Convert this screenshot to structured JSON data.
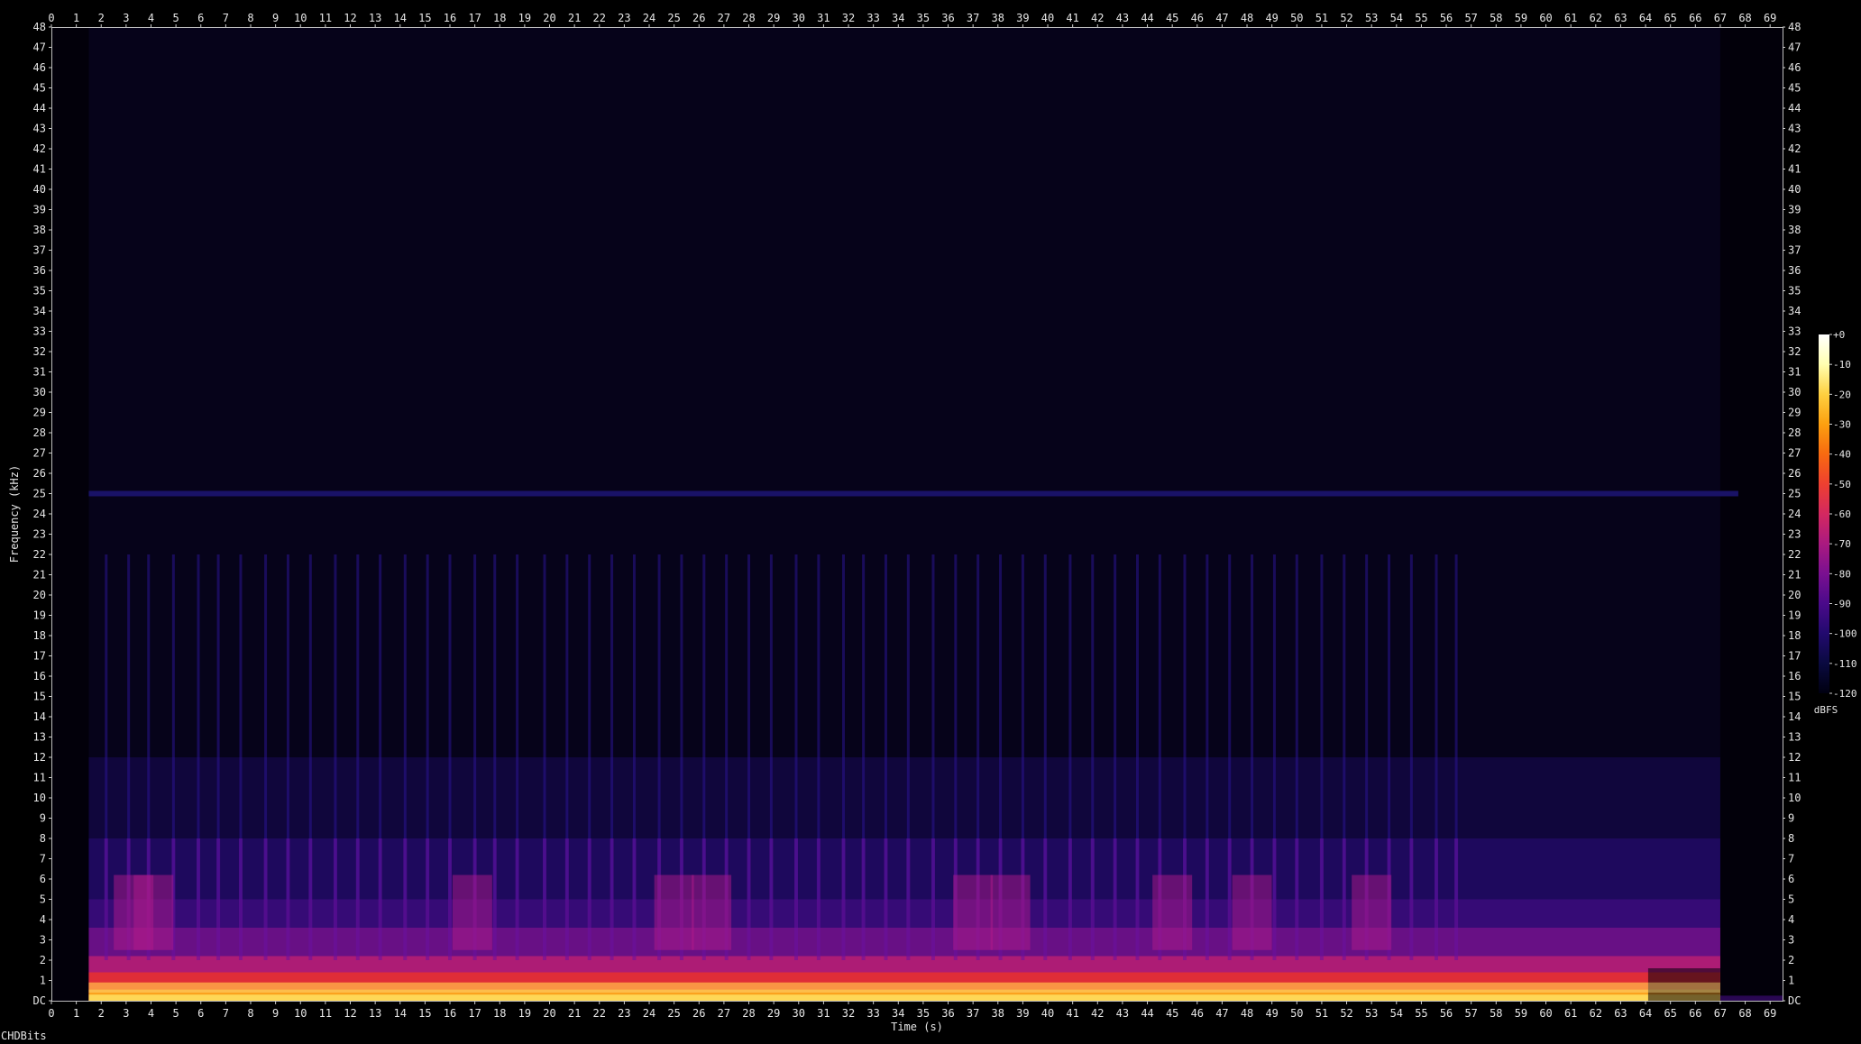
{
  "chart_data": {
    "type": "heatmap",
    "title": "",
    "xlabel": "Time (s)",
    "ylabel": "Frequency (kHz)",
    "xlim": [
      0,
      69.5
    ],
    "ylim": [
      0,
      48
    ],
    "x_ticks": [
      0,
      1,
      2,
      3,
      4,
      5,
      6,
      7,
      8,
      9,
      10,
      11,
      12,
      13,
      14,
      15,
      16,
      17,
      18,
      19,
      20,
      21,
      22,
      23,
      24,
      25,
      26,
      27,
      28,
      29,
      30,
      31,
      32,
      33,
      34,
      35,
      36,
      37,
      38,
      39,
      40,
      41,
      42,
      43,
      44,
      45,
      46,
      47,
      48,
      49,
      50,
      51,
      52,
      53,
      54,
      55,
      56,
      57,
      58,
      59,
      60,
      61,
      62,
      63,
      64,
      65,
      66,
      67,
      68,
      69
    ],
    "y_ticks": [
      "DC",
      "1",
      "2",
      "3",
      "4",
      "5",
      "6",
      "7",
      "8",
      "9",
      "10",
      "11",
      "12",
      "13",
      "14",
      "15",
      "16",
      "17",
      "18",
      "19",
      "20",
      "21",
      "22",
      "23",
      "24",
      "25",
      "26",
      "27",
      "28",
      "29",
      "30",
      "31",
      "32",
      "33",
      "34",
      "35",
      "36",
      "37",
      "38",
      "39",
      "40",
      "41",
      "42",
      "43",
      "44",
      "45",
      "46",
      "47",
      "48"
    ],
    "colorbar": {
      "unit": "dBFS",
      "ticks": [
        "+0",
        "-10",
        "-20",
        "-30",
        "-40",
        "-50",
        "-60",
        "-70",
        "-80",
        "-90",
        "-100",
        "-110",
        "-120"
      ],
      "range": [
        -120,
        0
      ],
      "colors": [
        "#000010",
        "#0a0a40",
        "#220a6e",
        "#4a0a8a",
        "#7a1090",
        "#aa1a80",
        "#d42860",
        "#ee4030",
        "#f86a10",
        "#fca010",
        "#fed040",
        "#ffffb0",
        "#ffffff"
      ]
    },
    "signal": {
      "start_s": 1.5,
      "end_s": 67.0,
      "tone_khz": 25.0,
      "strong_band_khz": [
        0,
        3
      ],
      "onsets_s": [
        2.2,
        3.1,
        3.9,
        4.9,
        5.9,
        6.7,
        7.6,
        8.6,
        9.5,
        10.4,
        11.4,
        12.3,
        13.2,
        14.2,
        15.1,
        16.0,
        17.0,
        17.8,
        18.7,
        19.8,
        20.7,
        21.6,
        22.5,
        23.4,
        24.4,
        25.3,
        26.2,
        27.1,
        28.0,
        28.9,
        29.9,
        30.8,
        31.8,
        32.6,
        33.5,
        34.4,
        35.4,
        36.3,
        37.2,
        38.1,
        39.0,
        39.9,
        40.9,
        41.8,
        42.7,
        43.6,
        44.5,
        45.5,
        46.4,
        47.3,
        48.2,
        49.1,
        50.0,
        51.0,
        51.9,
        52.8,
        53.7,
        54.6,
        55.6,
        56.4
      ],
      "accents_s": [
        3.3,
        4.1,
        16.9,
        25.0,
        26.5,
        37.0,
        38.5,
        45.0,
        48.2,
        53.0
      ]
    }
  },
  "footer": {
    "text": "CHDBits"
  }
}
